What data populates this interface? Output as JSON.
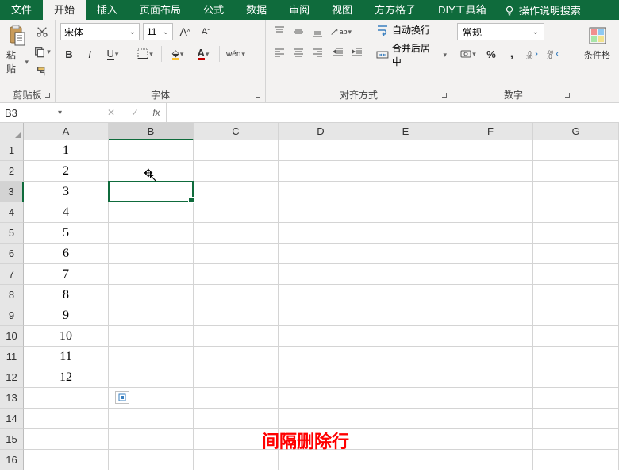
{
  "titlebar": {
    "file": "文件",
    "tabs": [
      "开始",
      "插入",
      "页面布局",
      "公式",
      "数据",
      "审阅",
      "视图",
      "方方格子",
      "DIY工具箱"
    ],
    "active_tab_index": 0,
    "search": "操作说明搜索"
  },
  "ribbon": {
    "clipboard": {
      "paste": "粘贴",
      "label": "剪贴板"
    },
    "font": {
      "name": "宋体",
      "size": "11",
      "bold": "B",
      "italic": "I",
      "underline": "U",
      "wen": "wén",
      "a_big": "A",
      "a_small": "A",
      "label": "字体"
    },
    "alignment": {
      "wrap": "自动换行",
      "merge": "合并后居中",
      "label": "对齐方式"
    },
    "number": {
      "format": "常规",
      "percent": "%",
      "comma": ",",
      "label": "数字"
    },
    "styles": {
      "cond": "条件格"
    }
  },
  "namebox": {
    "ref": "B3",
    "fx": "fx"
  },
  "sheet": {
    "columns": [
      "A",
      "B",
      "C",
      "D",
      "E",
      "F",
      "G"
    ],
    "rows": [
      "1",
      "2",
      "3",
      "4",
      "5",
      "6",
      "7",
      "8",
      "9",
      "10",
      "11",
      "12",
      "13",
      "14",
      "15",
      "16"
    ],
    "active_col": 1,
    "active_row": 2,
    "data_col_a": [
      "1",
      "2",
      "3",
      "4",
      "5",
      "6",
      "7",
      "8",
      "9",
      "10",
      "11",
      "12"
    ],
    "selected_cell": "B3"
  },
  "overlay": {
    "text": "间隔删除行"
  }
}
